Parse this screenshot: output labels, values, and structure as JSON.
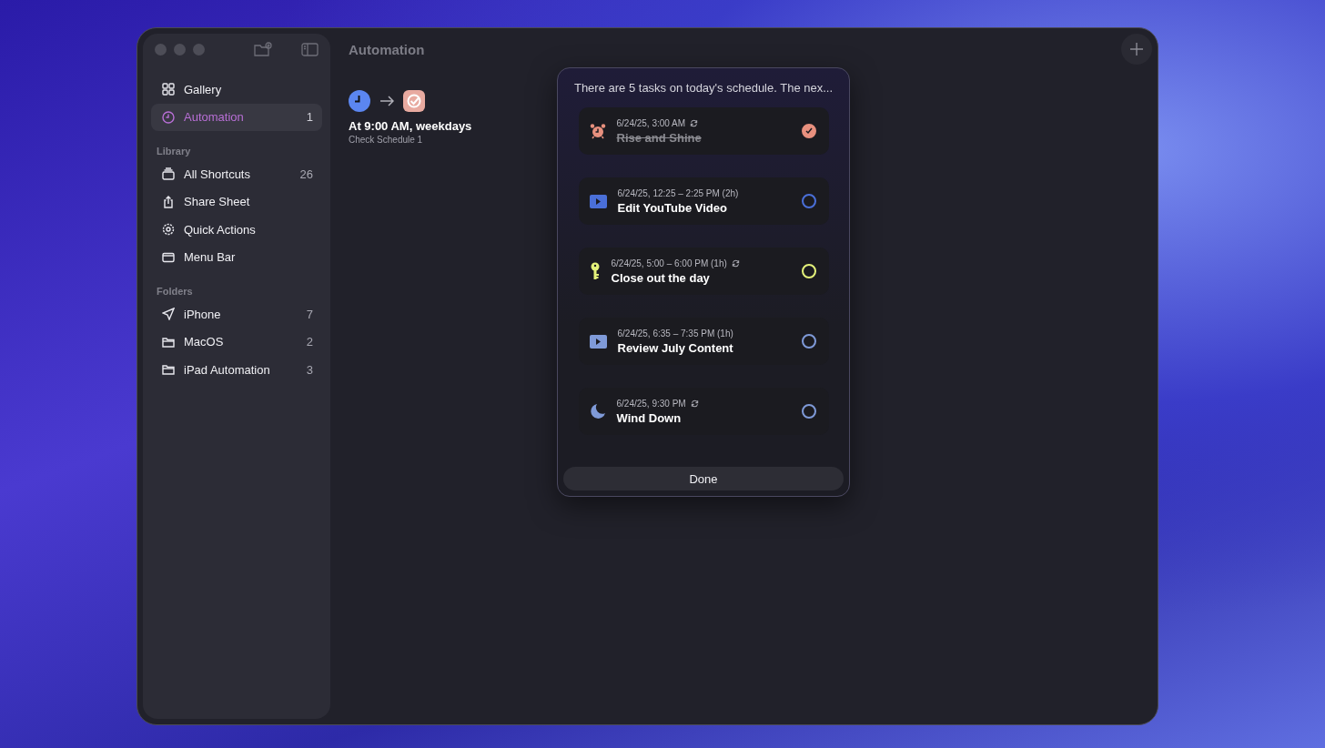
{
  "window": {
    "title": "Automation"
  },
  "sidebar": {
    "top_items": [
      {
        "kind": "grid",
        "label": "Gallery",
        "selected": false
      },
      {
        "kind": "clock",
        "label": "Automation",
        "count": "1",
        "selected": true
      }
    ],
    "sections": [
      {
        "title": "Library",
        "items": [
          {
            "kind": "stack",
            "label": "All Shortcuts",
            "count": "26",
            "selected": false
          },
          {
            "kind": "share",
            "label": "Share Sheet",
            "selected": false
          },
          {
            "kind": "gear",
            "label": "Quick Actions",
            "selected": false
          },
          {
            "kind": "window",
            "label": "Menu Bar",
            "selected": false
          }
        ]
      },
      {
        "title": "Folders",
        "items": [
          {
            "kind": "plane",
            "label": "iPhone",
            "count": "7",
            "selected": false
          },
          {
            "kind": "folder",
            "label": "MacOS",
            "count": "2",
            "selected": false
          },
          {
            "kind": "folder",
            "label": "iPad Automation",
            "count": "3",
            "selected": false
          }
        ]
      }
    ]
  },
  "automation": {
    "title": "At 9:00 AM, weekdays",
    "subtitle": "Check Schedule 1"
  },
  "dialog": {
    "message": "There are 5 tasks on today's schedule. The nex...",
    "tasks": [
      {
        "kind": "alarm",
        "color": "#e8907e",
        "time": "6/24/25, 3:00 AM",
        "repeats": true,
        "title": "Rise and Shine",
        "done": true
      },
      {
        "kind": "video",
        "color": "#4a6fd8",
        "time": "6/24/25, 12:25 – 2:25 PM (2h)",
        "repeats": false,
        "title": "Edit YouTube Video",
        "done": false
      },
      {
        "kind": "key",
        "color": "#e4f27a",
        "time": "6/24/25, 5:00 – 6:00 PM (1h)",
        "repeats": true,
        "title": "Close out the day",
        "done": false
      },
      {
        "kind": "video",
        "color": "#7f9ad8",
        "time": "6/24/25, 6:35 – 7:35 PM (1h)",
        "repeats": false,
        "title": "Review July Content",
        "done": false
      },
      {
        "kind": "moon",
        "color": "#7f9ad8",
        "time": "6/24/25, 9:30 PM",
        "repeats": true,
        "title": "Wind Down",
        "done": false
      }
    ],
    "button": "Done"
  }
}
